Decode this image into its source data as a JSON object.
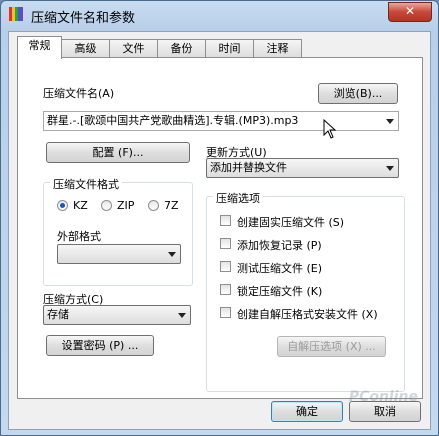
{
  "window": {
    "title": "压缩文件名和参数",
    "close_label": "✕"
  },
  "tabs": [
    {
      "label": "常规",
      "active": true
    },
    {
      "label": "高级",
      "active": false
    },
    {
      "label": "文件",
      "active": false
    },
    {
      "label": "备份",
      "active": false
    },
    {
      "label": "时间",
      "active": false
    },
    {
      "label": "注释",
      "active": false
    }
  ],
  "general": {
    "archive_name_label": "压缩文件名(A)",
    "browse_label": "浏览(B)...",
    "archive_name_value": "群星.-.[歌颂中国共产党歌曲精选].专辑.(MP3).mp3",
    "profiles_label": "配置 (F)...",
    "update_method_label": "更新方式(U)",
    "update_method_value": "添加并替换文件",
    "format_group_label": "压缩文件格式",
    "formats": [
      {
        "label": "KZ",
        "checked": true
      },
      {
        "label": "ZIP",
        "checked": false
      },
      {
        "label": "7Z",
        "checked": false
      }
    ],
    "external_format_label": "外部格式",
    "external_format_value": "",
    "compression_method_label": "压缩方式(C)",
    "compression_method_value": "存储",
    "set_password_label": "设置密码 (P) ...",
    "options_group_label": "压缩选项",
    "options": [
      {
        "label": "创建固实压缩文件 (S)",
        "checked": false
      },
      {
        "label": "添加恢复记录 (P)",
        "checked": false
      },
      {
        "label": "测试压缩文件 (E)",
        "checked": false
      },
      {
        "label": "锁定压缩文件 (K)",
        "checked": false
      },
      {
        "label": "创建自解压格式安装文件 (X)",
        "checked": false
      }
    ],
    "sfx_options_label": "自解压选项 (X) ..."
  },
  "footer": {
    "ok_label": "确定",
    "cancel_label": "取消"
  },
  "watermark": "PConline",
  "colors": {
    "title_bar": "#b7cfe9",
    "close_button": "#c7483a",
    "radio_dot": "#1a56b3"
  }
}
